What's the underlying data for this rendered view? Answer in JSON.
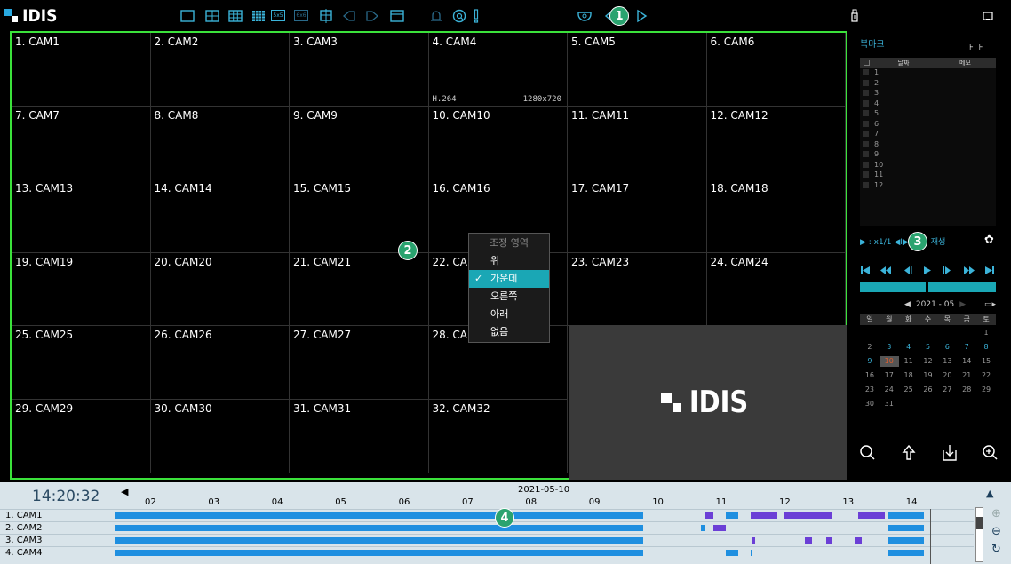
{
  "app": {
    "logo_text": "IDIS"
  },
  "toolbar": {
    "icons": [
      "layout-1x1-icon",
      "layout-2x2-icon",
      "layout-3x3-icon",
      "layout-4x4-icon",
      "layout-5x5-icon",
      "layout-6x6-icon",
      "layout-custom-icon",
      "prev-group-icon",
      "next-group-icon",
      "window-icon",
      "alarm-bell-icon",
      "rotate-search-icon",
      "alert-icon",
      "dome-camera-icon",
      "back-arrow-icon",
      "play-arrow-icon"
    ],
    "layout_5x5_label": "5x5",
    "layout_6x6_label": "6x6"
  },
  "badges": {
    "b1": "1",
    "b2": "2",
    "b3": "3",
    "b4": "4"
  },
  "cameras": [
    "1. CAM1",
    "2. CAM2",
    "3. CAM3",
    "4. CAM4",
    "5. CAM5",
    "6. CAM6",
    "7. CAM7",
    "8. CAM8",
    "9. CAM9",
    "10. CAM10",
    "11. CAM11",
    "12. CAM12",
    "13. CAM13",
    "14. CAM14",
    "15. CAM15",
    "16. CAM16",
    "17. CAM17",
    "18. CAM18",
    "19. CAM19",
    "20. CAM20",
    "21. CAM21",
    "22. CAM22",
    "23. CAM23",
    "24. CAM24",
    "25. CAM25",
    "26. CAM26",
    "27. CAM27",
    "28. CAM28",
    "",
    "",
    "29. CAM29",
    "30. CAM30",
    "31. CAM31",
    "32. CAM32",
    "",
    ""
  ],
  "cam4_codec": "H.264",
  "cam4_resolution": "1280x720",
  "idis_tile_logo": "IDIS",
  "context_menu": {
    "header": "조정 영역",
    "items": [
      {
        "label": "위",
        "selected": false
      },
      {
        "label": "가운데",
        "selected": true
      },
      {
        "label": "오른쪽",
        "selected": false
      },
      {
        "label": "아래",
        "selected": false
      },
      {
        "label": "없음",
        "selected": false
      }
    ],
    "check": "✓"
  },
  "bookmark": {
    "title": "북마크",
    "columns": [
      "날짜",
      "메모"
    ],
    "rows": [
      "1",
      "2",
      "3",
      "4",
      "5",
      "6",
      "7",
      "8",
      "9",
      "10",
      "11",
      "12"
    ]
  },
  "playback": {
    "speed_text": "▶ : x1/1 ◀I▶",
    "mode_text": "재생",
    "controls": [
      "skip-start-icon",
      "fast-rewind-icon",
      "step-back-icon",
      "play-icon",
      "step-forward-icon",
      "fast-forward-icon",
      "skip-end-icon"
    ]
  },
  "calendar": {
    "month_label": "2021 - 05",
    "weekdays": [
      "일",
      "월",
      "화",
      "수",
      "목",
      "금",
      "토"
    ],
    "days": [
      {
        "d": "",
        "c": ""
      },
      {
        "d": "",
        "c": ""
      },
      {
        "d": "",
        "c": ""
      },
      {
        "d": "",
        "c": ""
      },
      {
        "d": "",
        "c": ""
      },
      {
        "d": "",
        "c": ""
      },
      {
        "d": "1",
        "c": ""
      },
      {
        "d": "2",
        "c": ""
      },
      {
        "d": "3",
        "c": "blue"
      },
      {
        "d": "4",
        "c": "blue"
      },
      {
        "d": "5",
        "c": "blue"
      },
      {
        "d": "6",
        "c": "blue"
      },
      {
        "d": "7",
        "c": "blue"
      },
      {
        "d": "8",
        "c": "blue"
      },
      {
        "d": "9",
        "c": "blue"
      },
      {
        "d": "10",
        "c": "sel"
      },
      {
        "d": "11",
        "c": ""
      },
      {
        "d": "12",
        "c": ""
      },
      {
        "d": "13",
        "c": ""
      },
      {
        "d": "14",
        "c": ""
      },
      {
        "d": "15",
        "c": ""
      },
      {
        "d": "16",
        "c": ""
      },
      {
        "d": "17",
        "c": ""
      },
      {
        "d": "18",
        "c": ""
      },
      {
        "d": "19",
        "c": ""
      },
      {
        "d": "20",
        "c": ""
      },
      {
        "d": "21",
        "c": ""
      },
      {
        "d": "22",
        "c": ""
      },
      {
        "d": "23",
        "c": ""
      },
      {
        "d": "24",
        "c": ""
      },
      {
        "d": "25",
        "c": ""
      },
      {
        "d": "26",
        "c": ""
      },
      {
        "d": "27",
        "c": ""
      },
      {
        "d": "28",
        "c": ""
      },
      {
        "d": "29",
        "c": ""
      },
      {
        "d": "30",
        "c": ""
      },
      {
        "d": "31",
        "c": ""
      }
    ]
  },
  "timeline": {
    "clock": "14:20:32",
    "date": "2021-05-10",
    "hours": [
      "02",
      "03",
      "04",
      "05",
      "06",
      "07",
      "08",
      "09",
      "10",
      "11",
      "12",
      "13",
      "14"
    ],
    "channels": [
      "1. CAM1",
      "2. CAM2",
      "3. CAM3",
      "4. CAM4"
    ],
    "colors": {
      "continuous": "#1f8fe0",
      "event": "#6b3fd6"
    }
  }
}
